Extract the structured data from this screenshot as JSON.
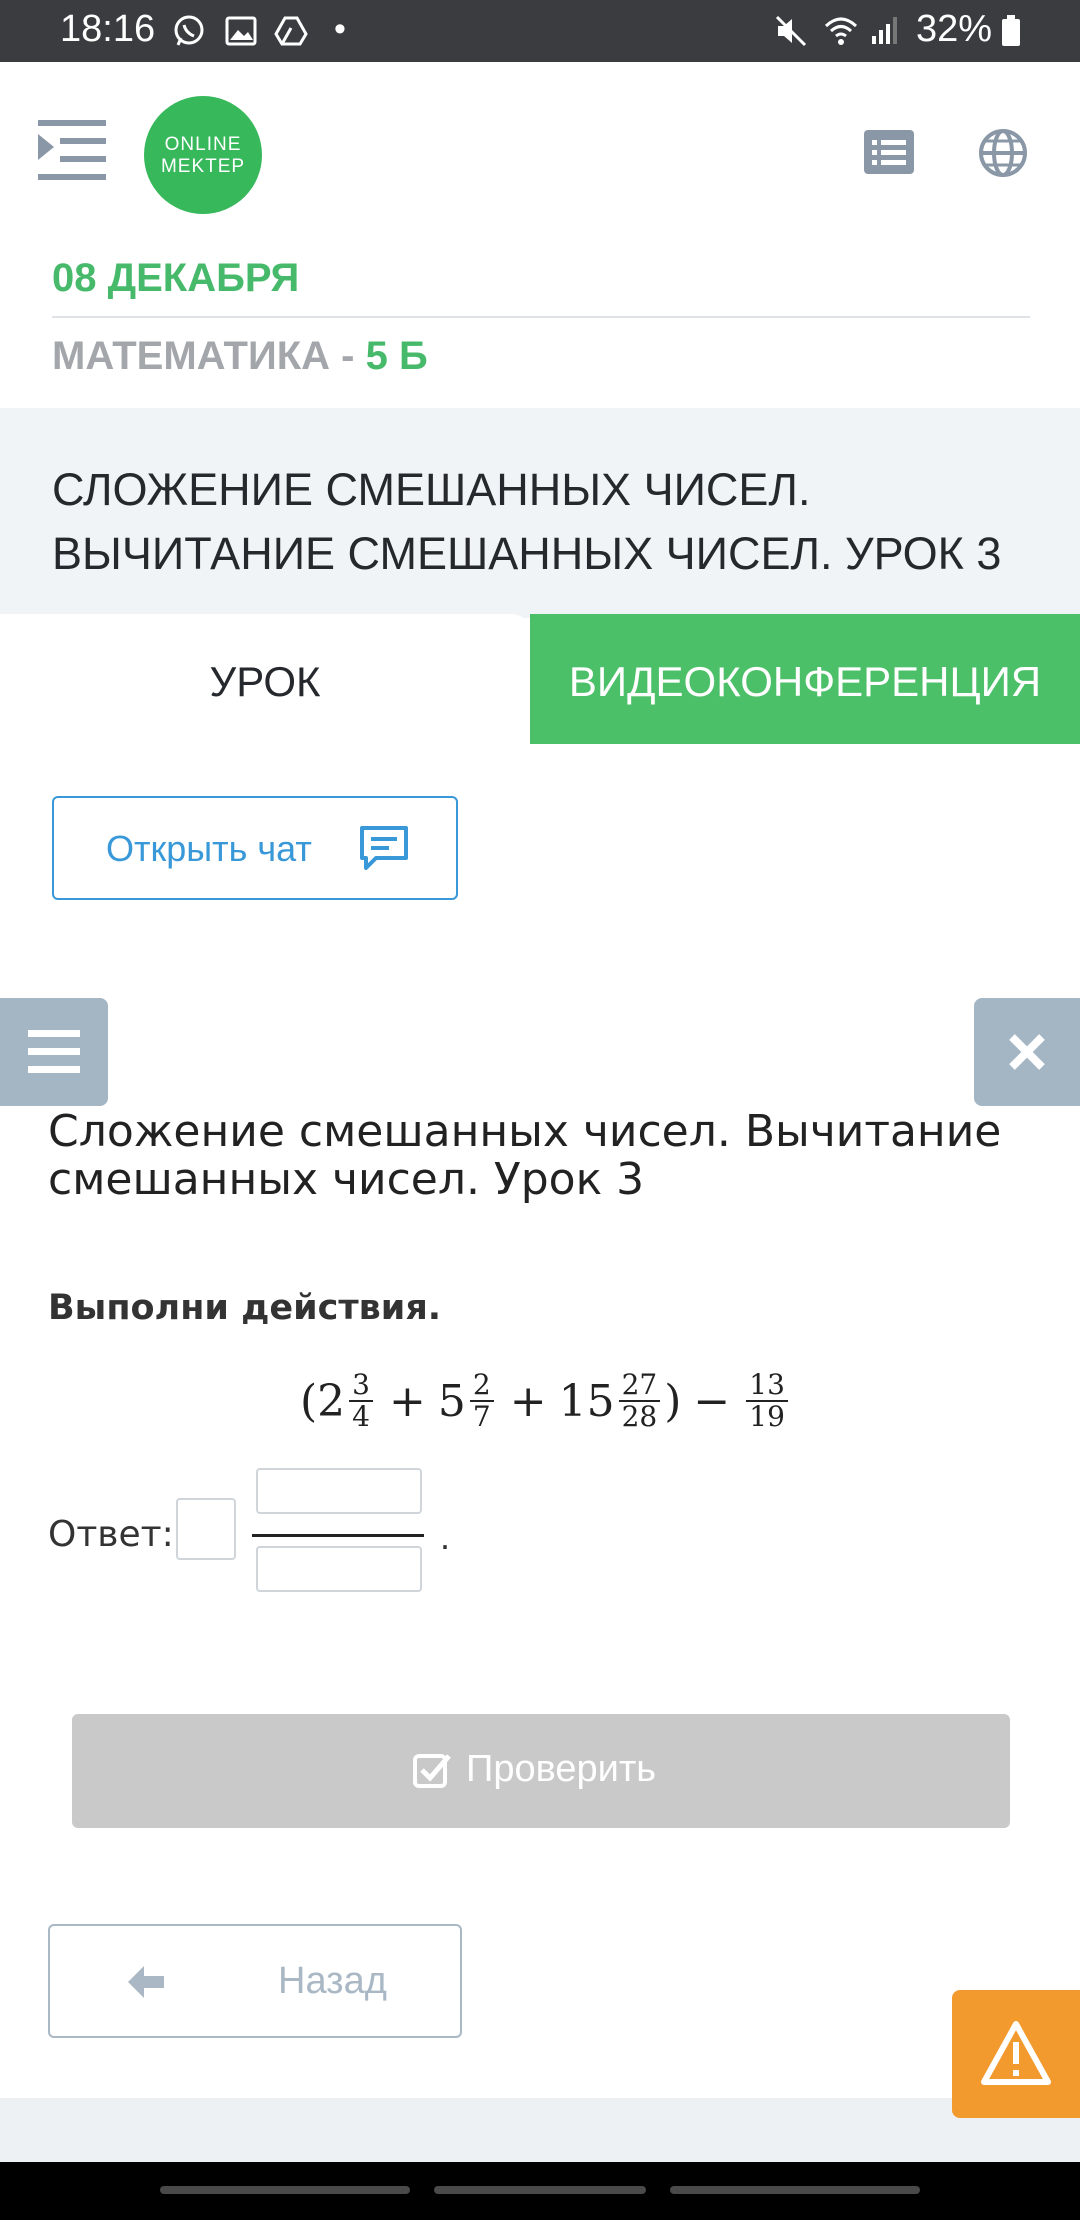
{
  "status_bar": {
    "time": "18:16",
    "dot": "•",
    "battery": "32%",
    "icons": [
      "whatsapp-icon",
      "gallery-icon",
      "drive-icon",
      "mute-icon",
      "wifi-icon",
      "signal-icon",
      "battery-icon"
    ]
  },
  "header": {
    "logo_line1": "ONLINE",
    "logo_line2": "MEKTEP",
    "date": "08 ДЕКАБРЯ",
    "subject": "МАТЕМАТИКА - ",
    "grade": "5 Б"
  },
  "lesson": {
    "title": "СЛОЖЕНИЕ СМЕШАННЫХ ЧИСЕЛ. ВЫЧИТАНИЕ СМЕШАННЫХ ЧИСЕЛ. УРОК 3"
  },
  "tabs": {
    "lesson": "УРОК",
    "video": "ВИДЕОКОНФЕРЕНЦИЯ"
  },
  "chat_button": "Открыть чат",
  "task": {
    "title": "Сложение смешанных чисел. Вычитание смешанных чисел. Урок 3",
    "instruction": "Выполни действия.",
    "expression": {
      "open": "(",
      "t1_whole": "2",
      "t1_num": "3",
      "t1_den": "4",
      "plus1": "+",
      "t2_whole": "5",
      "t2_num": "2",
      "t2_den": "7",
      "plus2": "+",
      "t3_whole": "15",
      "t3_num": "27",
      "t3_den": "28",
      "close": ")",
      "minus": "−",
      "t4_num": "13",
      "t4_den": "19"
    },
    "answer_label": "Ответ:",
    "answer_end": ".",
    "answer_whole": "",
    "answer_numerator": "",
    "answer_denominator": ""
  },
  "check_button": "Проверить",
  "back_button": "Назад",
  "colors": {
    "green": "#47b96b",
    "tab_green": "#4cc069",
    "blue": "#3898d8",
    "grey_button": "#c9c9c9",
    "orange": "#f39a2e"
  }
}
